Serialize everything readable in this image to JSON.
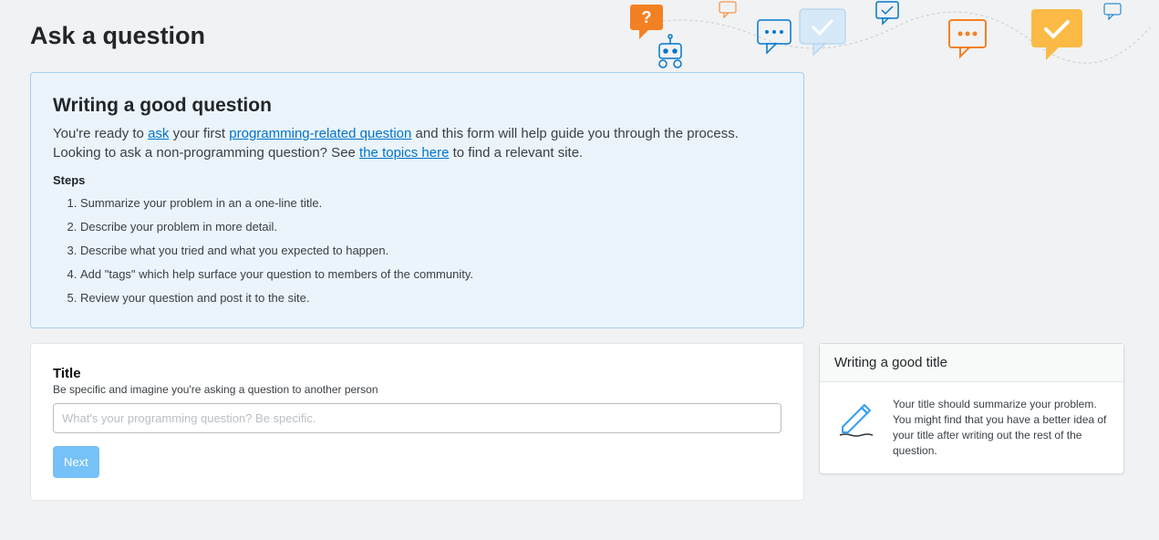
{
  "page": {
    "title": "Ask a question"
  },
  "info": {
    "title": "Writing a good question",
    "text_parts": {
      "p1": "You're ready to ",
      "link1": "ask",
      "p2": " your first ",
      "link2": "programming-related question",
      "p3": " and this form will help guide you through the process. Looking to ask a non-programming question? See ",
      "link3": "the topics here",
      "p4": " to find a relevant site."
    },
    "steps_label": "Steps",
    "steps": [
      "Summarize your problem in an a one-line title.",
      "Describe your problem in more detail.",
      "Describe what you tried and what you expected to happen.",
      "Add \"tags\" which help surface your question to members of the community.",
      "Review your question and post it to the site."
    ]
  },
  "title_card": {
    "label": "Title",
    "description": "Be specific and imagine you're asking a question to another person",
    "placeholder": "What's your programming question? Be specific.",
    "next": "Next"
  },
  "sidebar": {
    "header": "Writing a good title",
    "body": "Your title should summarize your problem. You might find that you have a better idea of your title after writing out the rest of the question."
  }
}
